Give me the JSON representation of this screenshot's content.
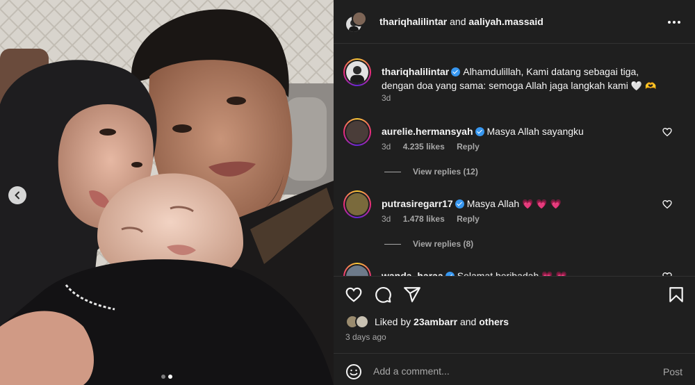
{
  "header": {
    "user1": "thariqhalilintar",
    "joiner": "and",
    "user2": "aaliyah.massaid",
    "more_icon": "more-horizontal-icon"
  },
  "caption": {
    "username": "thariqhalilintar",
    "text": "Alhamdulillah, Kami datang sebagai tiga, dengan doa yang sama: semoga Allah jaga langkah kami",
    "emoji": "🤍 🫶",
    "time": "3d"
  },
  "comments": [
    {
      "username": "aurelie.hermansyah",
      "text": "Masya Allah sayangku",
      "emoji": "",
      "time": "3d",
      "likes": "4.235 likes",
      "reply": "Reply",
      "view_replies": "View replies (12)"
    },
    {
      "username": "putrasiregarr17",
      "text": "Masya Allah",
      "emoji": "💗 💗 💗",
      "time": "3d",
      "likes": "1.478 likes",
      "reply": "Reply",
      "view_replies": "View replies (8)"
    },
    {
      "username": "wanda_haraa",
      "text": "Selamat beribadah",
      "emoji": "💗 💗"
    }
  ],
  "actions": {
    "like_icon": "heart-icon",
    "comment_icon": "comment-icon",
    "share_icon": "share-icon",
    "save_icon": "bookmark-icon"
  },
  "likes": {
    "prefix": "Liked by",
    "user": "23ambarr",
    "joiner": "and",
    "others": "others"
  },
  "posted": "3 days ago",
  "add_comment": {
    "placeholder": "Add a comment...",
    "post_label": "Post",
    "emoji_icon": "emoji-icon"
  },
  "carousel": {
    "current": 2,
    "total": 2
  },
  "colors": {
    "panel_bg": "#1f1f1f",
    "text": "#f5f5f5",
    "muted": "#a8a8a8",
    "verified": "#3797f0",
    "heart": "#ff3040"
  }
}
